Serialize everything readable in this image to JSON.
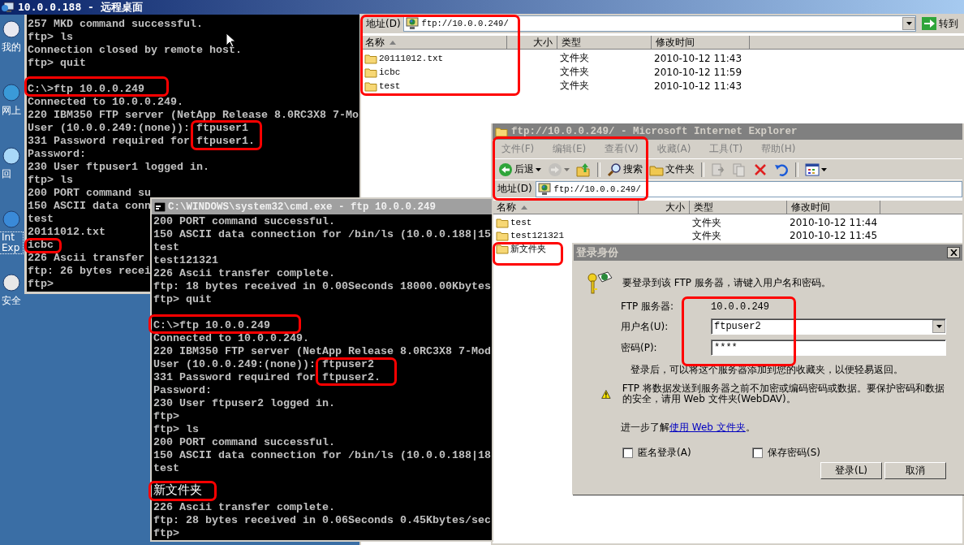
{
  "remote_desktop": {
    "title": "10.0.0.188 - 远程桌面"
  },
  "desktop_icons": [
    {
      "label": "我的",
      "focused": false
    },
    {
      "label": "网上",
      "focused": false
    },
    {
      "label": "回",
      "focused": false
    },
    {
      "label": "Int Exp",
      "focused": true
    },
    {
      "label": "安全",
      "focused": false
    }
  ],
  "console_back": {
    "blocks": [
      [
        "257 MKD command successful.",
        "ftp> ls",
        "Connection closed by remote host.",
        "ftp> quit"
      ],
      [
        "C:\\>ftp 10.0.0.249",
        "Connected to 10.0.0.249.",
        "220 IBM350 FTP server (NetApp Release 8.0RC3X8 7-Mo",
        "User (10.0.0.249:(none)): ftpuser1",
        "331 Password required for ftpuser1.",
        "Password:",
        "230 User ftpuser1 logged in.",
        "ftp> ls",
        "200 PORT command su",
        "150 ASCII data conn",
        "test",
        "20111012.txt",
        "icbc",
        "226 Ascii transfer",
        "ftp: 26 bytes recei",
        "ftp>"
      ]
    ]
  },
  "explorer": {
    "address_label": "地址(D)",
    "address": "ftp://10.0.0.249/",
    "go_button": "转到",
    "columns": [
      {
        "label": "名称",
        "sorted": true
      },
      {
        "label": "大小",
        "sorted": false
      },
      {
        "label": "类型",
        "sorted": false
      },
      {
        "label": "修改时间",
        "sorted": false
      }
    ],
    "rows": [
      {
        "name": "20111012.txt",
        "type": "文件夹",
        "modified": "2010-10-12 11:43"
      },
      {
        "name": "icbc",
        "type": "文件夹",
        "modified": "2010-10-12 11:59"
      },
      {
        "name": "test",
        "type": "文件夹",
        "modified": "2010-10-12 11:43"
      }
    ]
  },
  "ie_window": {
    "title": "ftp://10.0.0.249/ - Microsoft Internet Explorer",
    "menu": [
      "文件(F)",
      "编辑(E)",
      "查看(V)",
      "收藏(A)",
      "工具(T)",
      "帮助(H)"
    ],
    "toolbar": [
      {
        "kind": "back",
        "label": "后退",
        "disabled": false
      },
      {
        "kind": "forward",
        "disabled": true
      },
      {
        "kind": "up",
        "disabled": false
      },
      {
        "kind": "search",
        "label": "搜索",
        "disabled": false
      },
      {
        "kind": "folders",
        "label": "文件夹",
        "disabled": false
      },
      {
        "kind": "move",
        "disabled": true
      },
      {
        "kind": "copy",
        "disabled": true
      },
      {
        "kind": "delete",
        "disabled": false
      },
      {
        "kind": "undo",
        "disabled": false
      },
      {
        "kind": "views",
        "disabled": false
      }
    ],
    "address_label": "地址(D)",
    "address": "ftp://10.0.0.249/",
    "columns": [
      {
        "label": "名称",
        "sorted": true
      },
      {
        "label": "大小",
        "sorted": false
      },
      {
        "label": "类型",
        "sorted": false
      },
      {
        "label": "修改时间",
        "sorted": false
      }
    ],
    "rows": [
      {
        "name": "test",
        "type": "文件夹",
        "modified": "2010-10-12 11:44"
      },
      {
        "name": "test121321",
        "type": "文件夹",
        "modified": "2010-10-12 11:45"
      },
      {
        "name": "新文件夹"
      }
    ]
  },
  "login_dialog": {
    "title": "登录身份",
    "intro": "要登录到该 FTP 服务器，请键入用户名和密码。",
    "server_label": "FTP 服务器:",
    "server": "10.0.0.249",
    "username_label": "用户名(U):",
    "username": "ftpuser2",
    "password_label": "密码(P):",
    "password": "****",
    "note": "登录后，可以将这个服务器添加到您的收藏夹，以便轻易返回。",
    "warning": "FTP 将数据发送到服务器之前不加密或编码密码或数据。要保护密码和数据的安全，请用 Web 文件夹(WebDAV)。",
    "learn_more_prefix": "进一步了解",
    "learn_more_link": "使用 Web 文件夹",
    "learn_more_suffix": "。",
    "checkboxes": [
      {
        "label": "匿名登录(A)",
        "checked": false
      },
      {
        "label": "保存密码(S)",
        "checked": false
      }
    ],
    "buttons": [
      "登录(L)",
      "取消"
    ]
  },
  "console_front": {
    "title": "C:\\WINDOWS\\system32\\cmd.exe - ftp 10.0.0.249",
    "blocks": [
      [
        "200 PORT command successful.",
        "150 ASCII data connection for /bin/ls (10.0.0.188|15",
        "test",
        "test121321",
        "226 Ascii transfer complete.",
        "ftp: 18 bytes received in 0.00Seconds 18000.00Kbytes",
        "ftp> quit"
      ],
      [
        "C:\\>ftp 10.0.0.249",
        "Connected to 10.0.0.249.",
        "220 IBM350 FTP server (NetApp Release 8.0RC3X8 7-Mod",
        "User (10.0.0.249:(none)): ftpuser2",
        "331 Password required for ftpuser2.",
        "Password:",
        "230 User ftpuser2 logged in.",
        "ftp>",
        "ftp> ls",
        "200 PORT command successful.",
        "150 ASCII data connection for /bin/ls (10.0.0.188|18",
        "test",
        {
          "kind": "wide",
          "text": "新文件夹"
        },
        "226 Ascii transfer complete.",
        "ftp: 28 bytes received in 0.06Seconds 0.45Kbytes/sec",
        "ftp>"
      ]
    ]
  }
}
